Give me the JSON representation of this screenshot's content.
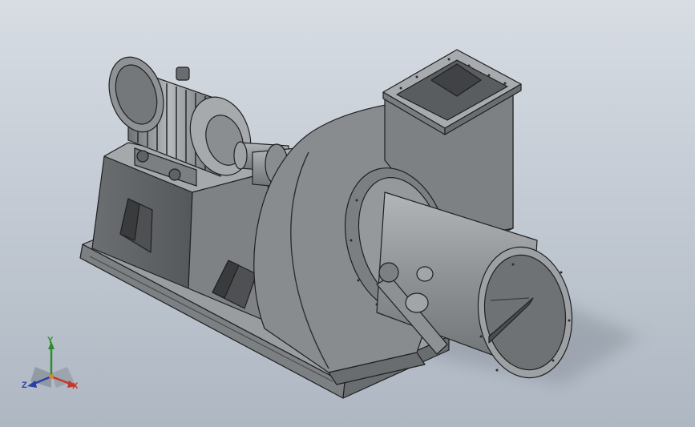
{
  "scene": {
    "background_top": "#d8dde4",
    "background_bottom": "#aeb7c2",
    "model_fill": "#8a8d90",
    "model_edge": "#1e1f21"
  },
  "triad": {
    "x_label": "X",
    "y_label": "Y",
    "z_label": "Z",
    "x_color": "#c0392b",
    "y_color": "#2e8b2e",
    "z_color": "#2b3fa8",
    "icon": "coordinate-triad-icon"
  }
}
